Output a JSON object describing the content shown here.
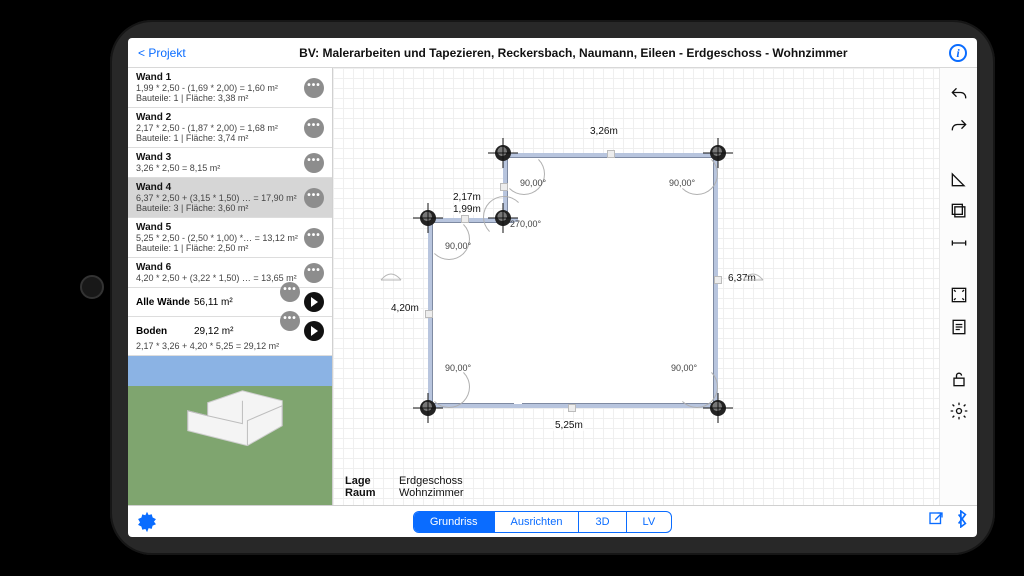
{
  "header": {
    "back": "< Projekt",
    "title": "BV: Malerarbeiten und Tapezieren, Reckersbach, Naumann, Eileen - Erdgeschoss - Wohnzimmer"
  },
  "walls": [
    {
      "name": "Wand 1",
      "calc": "1,99 * 2,50  - (1,69 * 2,00)  = 1,60 m²",
      "sub": "Bauteile: 1 | Fläche: 3,38 m²"
    },
    {
      "name": "Wand 2",
      "calc": "2,17 * 2,50  - (1,87 * 2,00)  = 1,68 m²",
      "sub": "Bauteile: 1 | Fläche: 3,74 m²"
    },
    {
      "name": "Wand 3",
      "calc": "3,26 * 2,50  = 8,15 m²",
      "sub": ""
    },
    {
      "name": "Wand 4",
      "calc": "6,37 * 2,50  + (3,15 * 1,50) … = 17,90 m²",
      "sub": "Bauteile: 3 | Fläche: 3,60 m²",
      "selected": true
    },
    {
      "name": "Wand 5",
      "calc": "5,25 * 2,50  - (2,50 * 1,00) *… = 13,12 m²",
      "sub": "Bauteile: 1 | Fläche: 2,50 m²"
    },
    {
      "name": "Wand 6",
      "calc": "4,20 * 2,50  + (3,22 * 1,50) … = 13,65 m²",
      "sub": ""
    }
  ],
  "summary": {
    "all_label": "Alle Wände",
    "all_value": "56,11 m²",
    "floor_label": "Boden",
    "floor_value": "29,12 m²",
    "floor_detail": "2,17 * 3,26  + 4,20 * 5,25  = 29,12 m²"
  },
  "plan": {
    "dims": {
      "top": "3,26m",
      "right": "6,37m",
      "bottom": "5,25m",
      "left": "4,20m",
      "notch_w": "2,17m",
      "notch_h": "1,99m"
    },
    "angles": {
      "tl": "90,00°",
      "tr": "90,00°",
      "inner_l": "90,00°",
      "inner_c": "270,00°",
      "bl": "90,00°",
      "br": "90,00°"
    }
  },
  "meta": {
    "lage_label": "Lage",
    "lage_value": "Erdgeschoss",
    "raum_label": "Raum",
    "raum_value": "Wohnzimmer"
  },
  "segments": {
    "a": "Grundriss",
    "b": "Ausrichten",
    "c": "3D",
    "d": "LV"
  }
}
